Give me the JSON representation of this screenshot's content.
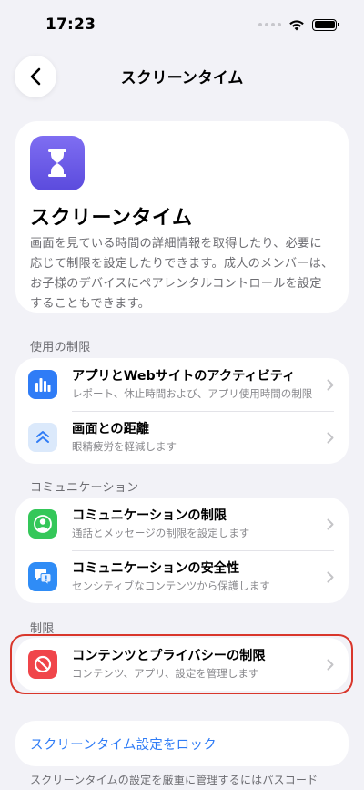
{
  "status_bar": {
    "time": "17:23"
  },
  "nav": {
    "title": "スクリーンタイム"
  },
  "hero": {
    "title": "スクリーンタイム",
    "description": "画面を見ている時間の詳細情報を取得したり、必要に応じて制限を設定したりできます。成人のメンバーは、お子様のデバイスにペアレンタルコントロールを設定することもできます。"
  },
  "sections": {
    "usage": {
      "header": "使用の制限",
      "rows": [
        {
          "title": "アプリとWebサイトのアクティビティ",
          "subtitle": "レポート、休止時間および、アプリ使用時間の制限",
          "icon": "bar-chart-icon",
          "color": "#2f7cf6"
        },
        {
          "title": "画面との距離",
          "subtitle": "眼精疲労を軽減します",
          "icon": "double-chevron-up-icon",
          "color": "#dbe9fb"
        }
      ]
    },
    "communication": {
      "header": "コミュニケーション",
      "rows": [
        {
          "title": "コミュニケーションの制限",
          "subtitle": "通話とメッセージの制限を設定します",
          "icon": "person-circle-icon",
          "color": "#34c759"
        },
        {
          "title": "コミュニケーションの安全性",
          "subtitle": "センシティブなコンテンツから保護します",
          "icon": "chat-bubble-alert-icon",
          "color": "#2f8cf6"
        }
      ]
    },
    "restrictions": {
      "header": "制限",
      "rows": [
        {
          "title": "コンテンツとプライバシーの制限",
          "subtitle": "コンテンツ、アプリ、設定を管理します",
          "icon": "prohibited-icon",
          "color": "#f0454a"
        }
      ]
    }
  },
  "lock": {
    "label": "スクリーンタイム設定をロック"
  },
  "footer": {
    "note": "スクリーンタイムの設定を厳重に管理するにはパスコード"
  },
  "colors": {
    "accent": "#2f7cf6",
    "highlight": "#d9372c",
    "background": "#f2f2f7"
  }
}
